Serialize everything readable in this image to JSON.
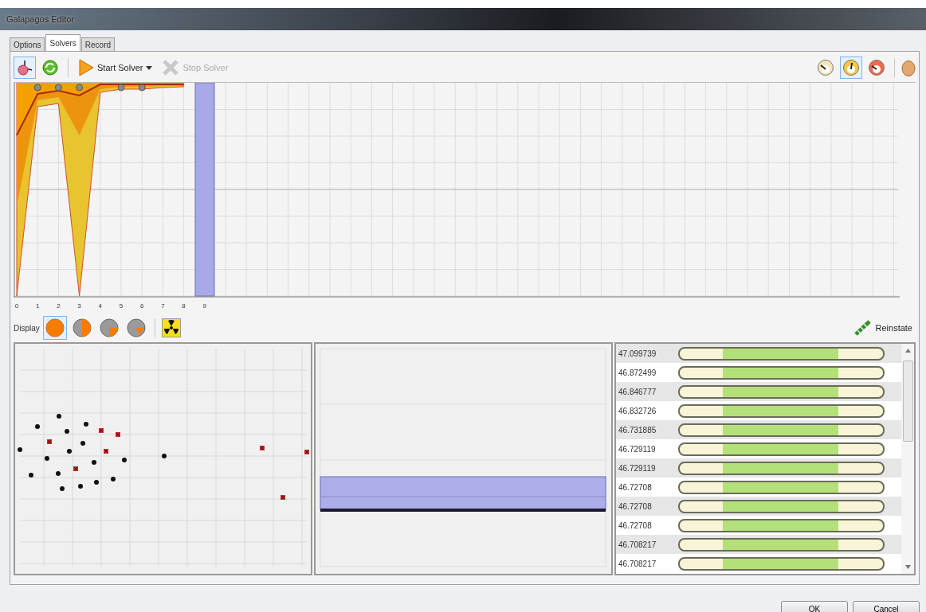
{
  "window": {
    "title": "Galapagos Editor"
  },
  "tabs": [
    {
      "label": "Options",
      "selected": false
    },
    {
      "label": "Solvers",
      "selected": true
    },
    {
      "label": "Record",
      "selected": false
    }
  ],
  "toolbar": {
    "tools": [
      {
        "kind": "pin",
        "selected": true
      },
      {
        "kind": "recycle",
        "selected": false
      }
    ],
    "start_button": {
      "label": "Start Solver",
      "disabled": false
    },
    "stop_button": {
      "label": "Stop Solver",
      "disabled": true
    },
    "speed_options": [
      {
        "selected": false
      },
      {
        "selected": true
      },
      {
        "selected": false
      }
    ]
  },
  "fitness_chart": {
    "x_tick_labels": [
      "0",
      "1",
      "2",
      "3",
      "4",
      "5",
      "6",
      "7",
      "8",
      "9"
    ]
  },
  "display_bar": {
    "label": "Display",
    "modes": [
      {
        "selected": true
      },
      {
        "selected": false
      },
      {
        "selected": false
      },
      {
        "selected": false
      }
    ],
    "reinstate_button": "Reinstate"
  },
  "genomes": [
    {
      "fitness": "47.099739"
    },
    {
      "fitness": "46.872499"
    },
    {
      "fitness": "46.846777"
    },
    {
      "fitness": "46.832726"
    },
    {
      "fitness": "46.731885"
    },
    {
      "fitness": "46.729119"
    },
    {
      "fitness": "46.729119"
    },
    {
      "fitness": "46.72708"
    },
    {
      "fitness": "46.72708"
    },
    {
      "fitness": "46.72708"
    },
    {
      "fitness": "46.708217"
    },
    {
      "fitness": "46.708217"
    }
  ],
  "footer_buttons": [
    "OK",
    "Cancel"
  ]
}
